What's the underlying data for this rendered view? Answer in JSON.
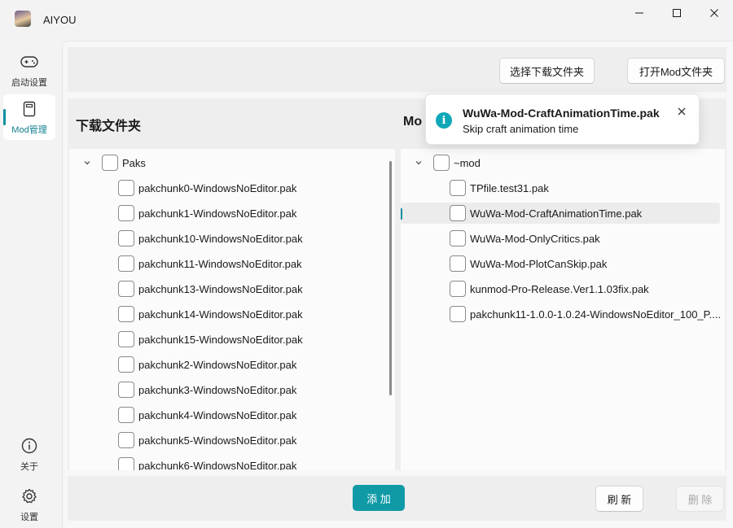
{
  "app": {
    "title": "AIYOU"
  },
  "nav": {
    "items": [
      {
        "label": "启动设置",
        "icon": "gamepad-icon"
      },
      {
        "label": "Mod管理",
        "icon": "book-icon",
        "active": true
      }
    ],
    "bottom": [
      {
        "label": "关于",
        "icon": "info-icon"
      },
      {
        "label": "设置",
        "icon": "gear-icon"
      }
    ]
  },
  "toolbar": {
    "select_download_folder": "选择下载文件夹",
    "open_mod_folder": "打开Mod文件夹"
  },
  "left_panel": {
    "title": "下载文件夹",
    "root": "Paks",
    "items": [
      "pakchunk0-WindowsNoEditor.pak",
      "pakchunk1-WindowsNoEditor.pak",
      "pakchunk10-WindowsNoEditor.pak",
      "pakchunk11-WindowsNoEditor.pak",
      "pakchunk13-WindowsNoEditor.pak",
      "pakchunk14-WindowsNoEditor.pak",
      "pakchunk15-WindowsNoEditor.pak",
      "pakchunk2-WindowsNoEditor.pak",
      "pakchunk3-WindowsNoEditor.pak",
      "pakchunk4-WindowsNoEditor.pak",
      "pakchunk5-WindowsNoEditor.pak",
      "pakchunk6-WindowsNoEditor.pak"
    ]
  },
  "right_panel": {
    "title": "Mo",
    "root": "~mod",
    "items": [
      "TPfile.test31.pak",
      "WuWa-Mod-CraftAnimationTime.pak",
      "WuWa-Mod-OnlyCritics.pak",
      "WuWa-Mod-PlotCanSkip.pak",
      "kunmod-Pro-Release.Ver1.1.03fix.pak",
      "pakchunk11-1.0.0-1.0.24-WindowsNoEditor_100_P...."
    ],
    "selected_index": 1
  },
  "actions": {
    "add": "添 加",
    "refresh": "刷 新",
    "delete": "删 除"
  },
  "toast": {
    "title": "WuWa-Mod-CraftAnimationTime.pak",
    "message": "Skip craft animation time",
    "icon": "info-icon"
  },
  "colors": {
    "accent": "#0f9aa6",
    "info": "#0fa8b8"
  }
}
